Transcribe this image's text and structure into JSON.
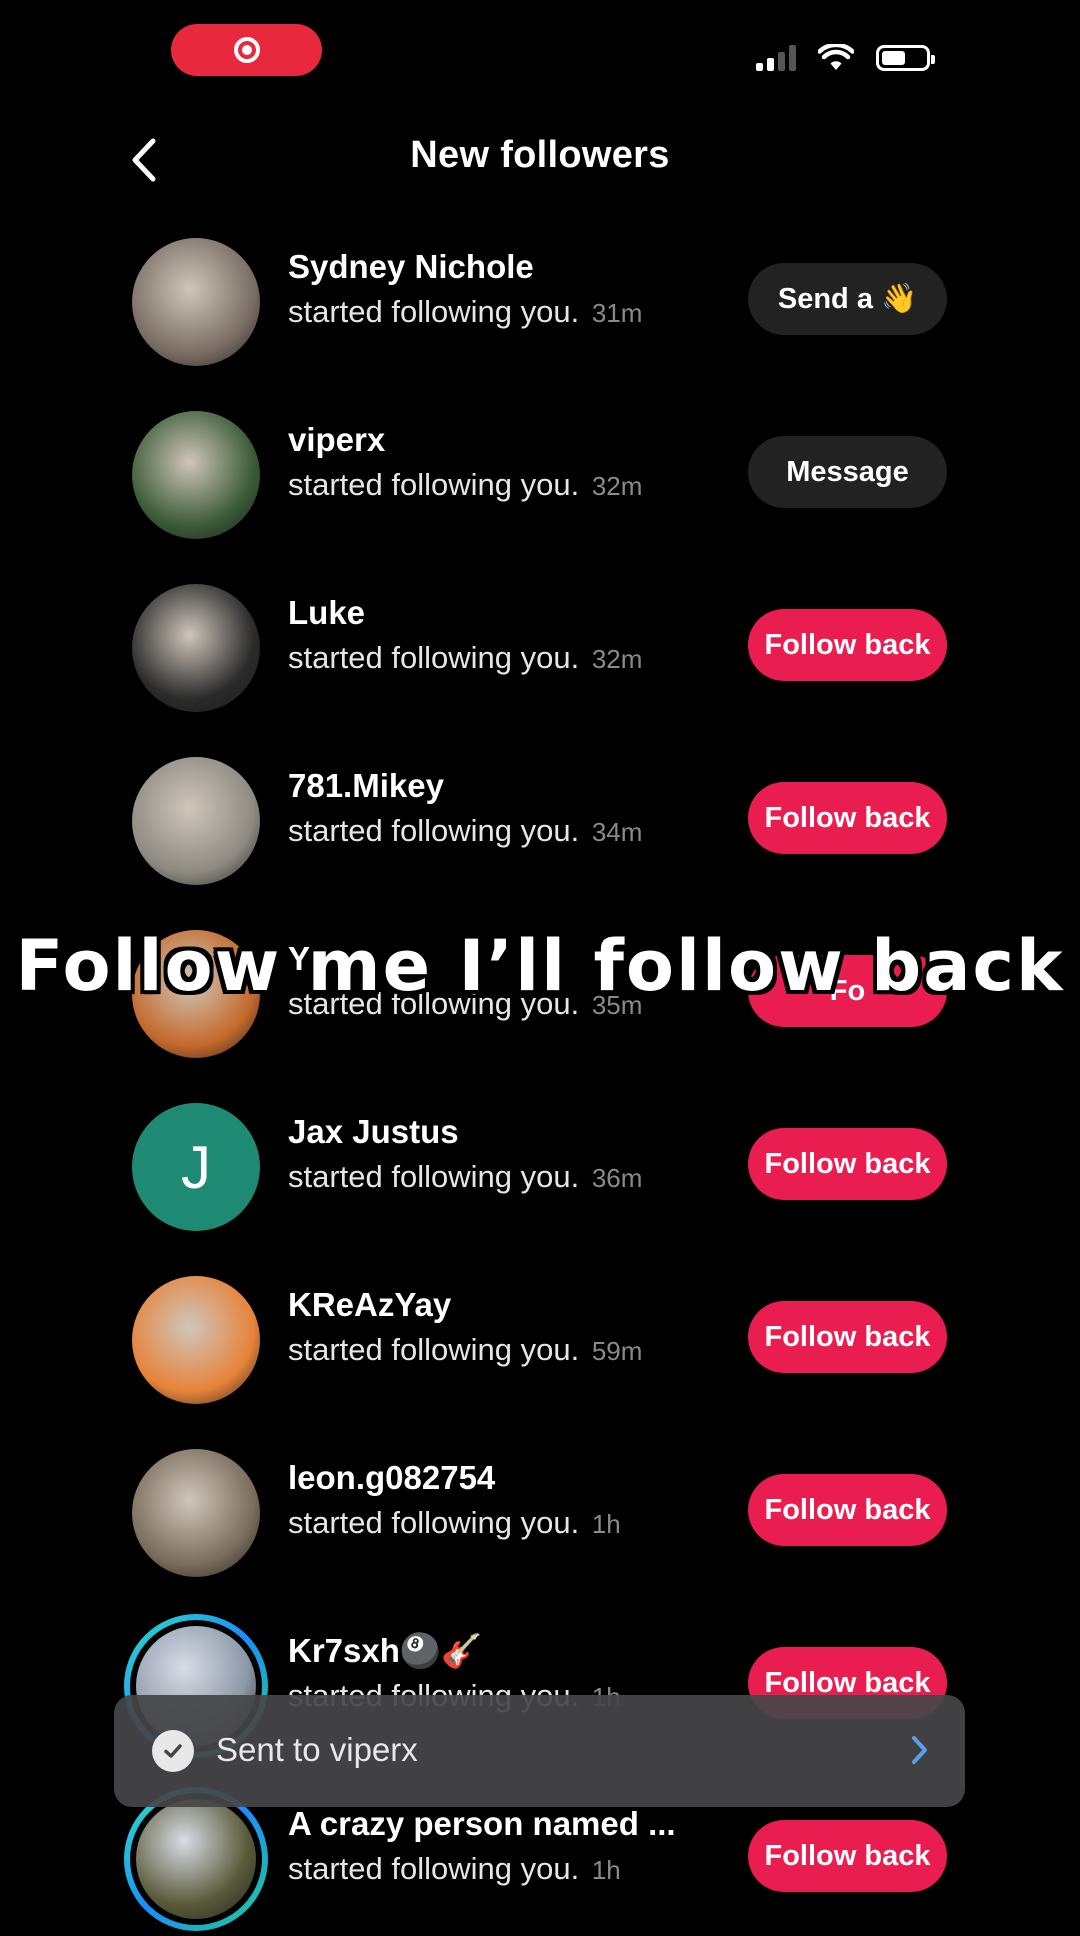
{
  "status_bar": {
    "recording_icon": "record-icon",
    "signal_bars_active": 2,
    "signal_bars_total": 4,
    "battery_level": 0.55
  },
  "header": {
    "title": "New followers",
    "back_icon": "chevron-left-icon"
  },
  "followers": [
    {
      "name": "Sydney Nichole",
      "action": "started following you.",
      "time": "31m",
      "button": "Send a 👋",
      "button_style": "dark",
      "avatar_color": "#7a6e64"
    },
    {
      "name": "viperx",
      "action": "started following you.",
      "time": "32m",
      "button": "Message",
      "button_style": "dark",
      "avatar_color": "#3a5a36"
    },
    {
      "name": "Luke",
      "action": "started following you.",
      "time": "32m",
      "button": "Follow back",
      "button_style": "red",
      "avatar_color": "#2a2a2a"
    },
    {
      "name": "781.Mikey",
      "action": "started following you.",
      "time": "34m",
      "button": "Follow back",
      "button_style": "red",
      "avatar_color": "#8e8a82"
    },
    {
      "name": "Y",
      "action": "started following you.",
      "time": "35m",
      "button": "Fo",
      "button_style": "red",
      "avatar_color": "#c46a2c"
    },
    {
      "name": "Jax Justus",
      "action": "started following you.",
      "time": "36m",
      "button": "Follow back",
      "button_style": "red",
      "avatar_color": "#1e8a74",
      "initial": "J"
    },
    {
      "name": "KReAzYay",
      "action": "started following you.",
      "time": "59m",
      "button": "Follow back",
      "button_style": "red",
      "avatar_color": "#e6833a"
    },
    {
      "name": "leon.g082754",
      "action": "started following you.",
      "time": "1h",
      "button": "Follow back",
      "button_style": "red",
      "avatar_color": "#7b6c5c"
    },
    {
      "name": "Kr7sxh🎱🎸",
      "action": "started following you.",
      "time": "1h",
      "button": "Follow back",
      "button_style": "red",
      "avatar_color": "#8c98a8",
      "story": true
    },
    {
      "name": "A crazy person named ...",
      "action": "started following you.",
      "time": "1h",
      "button": "Follow back",
      "button_style": "red",
      "avatar_color": "#5a5a3a",
      "story": true
    }
  ],
  "caption": "Follow me I’ll follow back",
  "toast": {
    "message": "Sent to viperx",
    "icon": "check-circle-icon",
    "chevron_icon": "chevron-right-icon",
    "chevron_color": "#5aa0e6"
  }
}
